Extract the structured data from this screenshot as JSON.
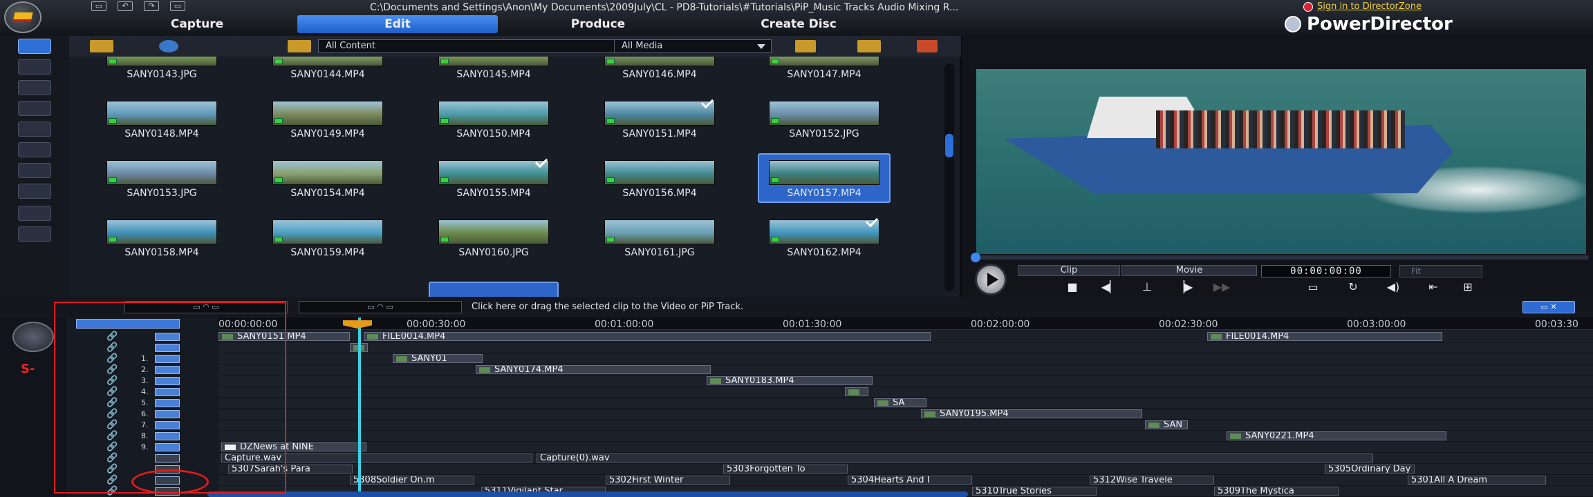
{
  "window": {
    "title": "C:\\Documents and Settings\\Anon\\My Documents\\2009July\\CL - PD8-Tutorials\\#Tutorials\\PiP_Music Tracks Audio Mixing R...",
    "signin": "Sign in to DirectorZone",
    "brand": "PowerDirector"
  },
  "tabs": [
    {
      "label": "Capture"
    },
    {
      "label": "Edit",
      "active": true
    },
    {
      "label": "Produce"
    },
    {
      "label": "Create Disc"
    }
  ],
  "library": {
    "content_filter": "All Content",
    "media_filter": "All Media",
    "items": [
      {
        "name": "SANY0143.JPG",
        "color": "#7fa45a"
      },
      {
        "name": "SANY0144.MP4",
        "color": "#8aa96a"
      },
      {
        "name": "SANY0145.MP4",
        "color": "#86a35b"
      },
      {
        "name": "SANY0146.MP4",
        "color": "#7a9a5f",
        "checked": true
      },
      {
        "name": "SANY0147.MP4",
        "color": "#8aa26a"
      },
      {
        "name": "SANY0148.MP4",
        "color": "#5f98b8"
      },
      {
        "name": "SANY0149.MP4",
        "color": "#7c8a5a"
      },
      {
        "name": "SANY0150.MP4",
        "color": "#4a9ba8"
      },
      {
        "name": "SANY0151.MP4",
        "color": "#4b86a0",
        "checked": true
      },
      {
        "name": "SANY0152.JPG",
        "color": "#6a8ea8"
      },
      {
        "name": "SANY0153.JPG",
        "color": "#6c88a8"
      },
      {
        "name": "SANY0154.MP4",
        "color": "#8aa070"
      },
      {
        "name": "SANY0155.MP4",
        "color": "#3e8f94",
        "checked": true
      },
      {
        "name": "SANY0156.MP4",
        "color": "#3f8990"
      },
      {
        "name": "SANY0157.MP4",
        "color": "#3b7f80",
        "selected": true
      },
      {
        "name": "SANY0158.MP4",
        "color": "#3c8fb6"
      },
      {
        "name": "SANY0159.MP4",
        "color": "#4a9fc4"
      },
      {
        "name": "SANY0160.JPG",
        "color": "#6b8a4a"
      },
      {
        "name": "SANY0161.JPG",
        "color": "#6a9fb2"
      },
      {
        "name": "SANY0162.MP4",
        "color": "#3f94bc",
        "checked": true
      }
    ]
  },
  "preview": {
    "segments": {
      "clip": "Clip",
      "movie": "Movie"
    },
    "timecode": "00:00:00:00",
    "fit": "Fit"
  },
  "timeline": {
    "hint": "Click here or drag the selected clip to the Video or PiP Track.",
    "ruler": [
      "00:00:00:00",
      "00:00:30:00",
      "00:01:00:00",
      "00:01:30:00",
      "00:02:00:00",
      "00:02:30:00",
      "00:03:00:00",
      "00:03:30"
    ],
    "track_numbers": [
      "1.",
      "2.",
      "3.",
      "4.",
      "5.",
      "6.",
      "7.",
      "8.",
      "9."
    ],
    "clips": [
      {
        "lane": 0,
        "label": "SANY0151.MP4",
        "start": 0,
        "len": 190,
        "type": "video"
      },
      {
        "lane": 0,
        "label": "FILE0014.MP4",
        "start": 210,
        "len": 820,
        "type": "video"
      },
      {
        "lane": 0,
        "label": "FILE0014.MP4",
        "start": 1430,
        "len": 340,
        "type": "video"
      },
      {
        "lane": 1,
        "label": "",
        "start": 190,
        "len": 26,
        "type": "video"
      },
      {
        "lane": 2,
        "label": "SANY01",
        "start": 252,
        "len": 130,
        "type": "video"
      },
      {
        "lane": 3,
        "label": "SANY0174.MP4",
        "start": 372,
        "len": 340,
        "type": "video"
      },
      {
        "lane": 4,
        "label": "SANY0183.MP4",
        "start": 706,
        "len": 240,
        "type": "video"
      },
      {
        "lane": 5,
        "label": "",
        "start": 906,
        "len": 34,
        "type": "video"
      },
      {
        "lane": 6,
        "label": "SA",
        "start": 948,
        "len": 76,
        "type": "video"
      },
      {
        "lane": 7,
        "label": "SANY0195.MP4",
        "start": 1016,
        "len": 320,
        "type": "video"
      },
      {
        "lane": 8,
        "label": "SAN",
        "start": 1340,
        "len": 62,
        "type": "video"
      },
      {
        "lane": 9,
        "label": "SANY0221.MP4",
        "start": 1458,
        "len": 318,
        "type": "video"
      },
      {
        "lane": 10,
        "label": "DZNews at NINE",
        "start": 4,
        "len": 210,
        "type": "title"
      },
      {
        "lane": 11,
        "label": "Capture.wav",
        "start": 4,
        "len": 450,
        "type": "audio"
      },
      {
        "lane": 11,
        "label": "Capture(0).wav",
        "start": 460,
        "len": 1210,
        "type": "audio"
      },
      {
        "lane": 12,
        "label": "5307Sarah's Para",
        "start": 14,
        "len": 180,
        "type": "audio"
      },
      {
        "lane": 12,
        "label": "5303Forgotten To",
        "start": 730,
        "len": 180,
        "type": "audio"
      },
      {
        "lane": 12,
        "label": "5305Ordinary Day",
        "start": 1600,
        "len": 130,
        "type": "audio"
      },
      {
        "lane": 13,
        "label": "5308Soldier On.m",
        "start": 190,
        "len": 180,
        "type": "audio"
      },
      {
        "lane": 13,
        "label": "5302First Winter",
        "start": 560,
        "len": 180,
        "type": "audio"
      },
      {
        "lane": 13,
        "label": "5304Hearts And I",
        "start": 910,
        "len": 180,
        "type": "audio"
      },
      {
        "lane": 13,
        "label": "5312Wise Travele",
        "start": 1260,
        "len": 180,
        "type": "audio"
      },
      {
        "lane": 13,
        "label": "5301All A Dream",
        "start": 1720,
        "len": 200,
        "type": "audio"
      },
      {
        "lane": 14,
        "label": "5311Vigilant Star",
        "start": 380,
        "len": 180,
        "type": "audio"
      },
      {
        "lane": 14,
        "label": "5310True Stories",
        "start": 1090,
        "len": 180,
        "type": "audio"
      },
      {
        "lane": 14,
        "label": "5309The Mystica",
        "start": 1440,
        "len": 180,
        "type": "audio"
      }
    ]
  }
}
